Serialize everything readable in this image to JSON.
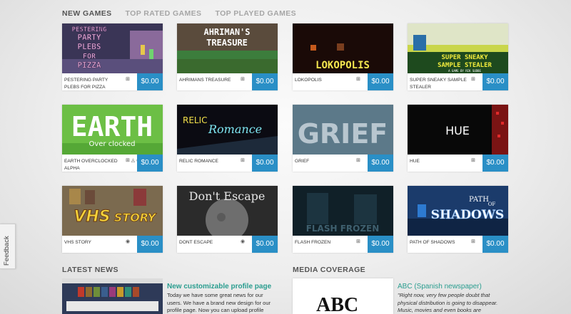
{
  "tabs": [
    "NEW GAMES",
    "TOP RATED GAMES",
    "TOP PLAYED GAMES"
  ],
  "games": [
    {
      "name": "PESTERING PARTY PLEBS FOR PIZZA",
      "platforms": "⊞",
      "price": "$0.00",
      "thumb_text": [
        "PESTERING",
        "PARTY",
        "PLEBS",
        "FOR",
        "PIZZA"
      ],
      "icon": "windows-icon"
    },
    {
      "name": "AHRIMANS TREASURE",
      "platforms": "⊞",
      "price": "$0.00",
      "thumb_text": [
        "AHRIMAN'S",
        "TREASURE"
      ],
      "icon": "windows-icon"
    },
    {
      "name": "LOKOPOLIS",
      "platforms": "⊞",
      "price": "$0.00",
      "thumb_text": [
        "LOKOPOLIS"
      ],
      "icon": "windows-icon"
    },
    {
      "name": "SUPER SNEAKY SAMPLE STEALER",
      "platforms": "⊞",
      "price": "$0.00",
      "thumb_text": [
        "SUPER SNEAKY",
        "SAMPLE STEALER",
        "A GAME BY RIK SUDBE"
      ],
      "icon": "windows-icon"
    },
    {
      "name": "EARTH OVERCLOCKED ALPHA",
      "platforms": "⊞ ◬ ◍",
      "price": "$0.00",
      "thumb_text": [
        "EARTH",
        "Over clocked"
      ],
      "icon": "windows-icon"
    },
    {
      "name": "RELIC ROMANCE",
      "platforms": "⊞",
      "price": "$0.00",
      "thumb_text": [
        "RELIC",
        "Romance"
      ],
      "icon": "windows-icon"
    },
    {
      "name": "GRIEF",
      "platforms": "⊞",
      "price": "$0.00",
      "thumb_text": [
        "GRIEF"
      ],
      "icon": "windows-icon"
    },
    {
      "name": "HUE",
      "platforms": "⊞",
      "price": "$0.00",
      "thumb_text": [
        "HUE"
      ],
      "icon": "windows-icon"
    },
    {
      "name": "VHS STORY",
      "platforms": "◉",
      "price": "$0.00",
      "thumb_text": [
        "VHS",
        "STORY"
      ],
      "icon": "chrome-icon"
    },
    {
      "name": "DONT ESCAPE",
      "platforms": "◉",
      "price": "$0.00",
      "thumb_text": [
        "Don't Escape"
      ],
      "icon": "chrome-icon"
    },
    {
      "name": "FLASH FROZEN",
      "platforms": "⊞",
      "price": "$0.00",
      "thumb_text": [
        "FLASH FROZEN"
      ],
      "icon": "windows-icon"
    },
    {
      "name": "PATH OF SHADOWS",
      "platforms": "⊞",
      "price": "$0.00",
      "thumb_text": [
        "PATH",
        "OF",
        "SHADOWS"
      ],
      "icon": "windows-icon"
    }
  ],
  "latest_news": {
    "title": "LATEST NEWS",
    "headline": "New customizable profile page",
    "body": "Today we have some great news for our users. We have a brand new design for our profile page. Now you can upload profile and"
  },
  "media": {
    "title": "MEDIA COVERAGE",
    "logo_text": "ABC",
    "headline": "ABC (Spanish newspaper)",
    "body": "\"Right now, very few people doubt that physical distribution is going to disappear. Music, movies and even books are measured"
  },
  "feedback_label": "Feedback",
  "colors": {
    "price_bg": "#2a8fc6",
    "link": "#2a9d8f"
  }
}
